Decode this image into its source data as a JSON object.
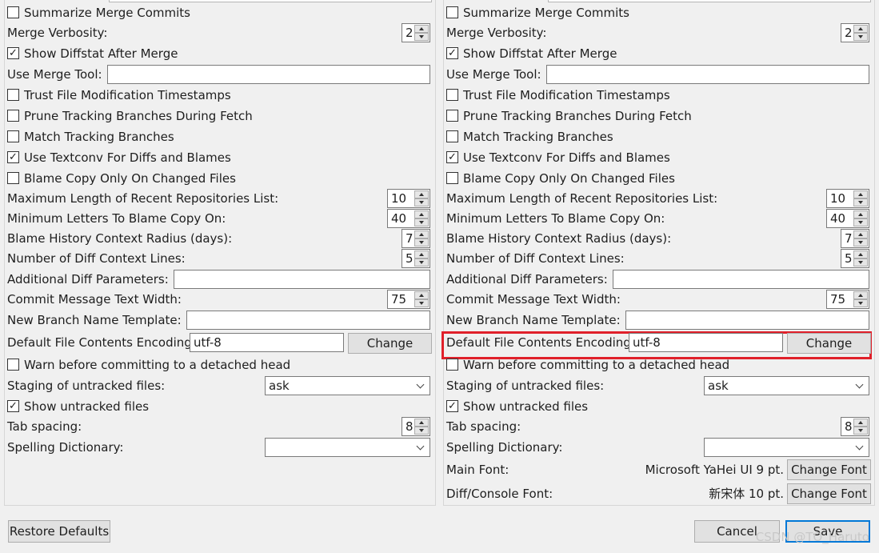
{
  "panels": [
    {
      "items": [
        {
          "kind": "checkbox",
          "label": "Summarize Merge Commits",
          "checked": false
        },
        {
          "kind": "spin",
          "label": "Merge Verbosity:",
          "value": "2"
        },
        {
          "kind": "checkbox",
          "label": "Show Diffstat After Merge",
          "checked": true
        },
        {
          "kind": "input",
          "label": "Use Merge Tool:",
          "value": ""
        },
        {
          "kind": "checkbox",
          "label": "Trust File Modification Timestamps",
          "checked": false
        },
        {
          "kind": "checkbox",
          "label": "Prune Tracking Branches During Fetch",
          "checked": false
        },
        {
          "kind": "checkbox",
          "label": "Match Tracking Branches",
          "checked": false
        },
        {
          "kind": "checkbox",
          "label": "Use Textconv For Diffs and Blames",
          "checked": true
        },
        {
          "kind": "checkbox",
          "label": "Blame Copy Only On Changed Files",
          "checked": false
        },
        {
          "kind": "spin",
          "label": "Maximum Length of Recent Repositories List:",
          "value": "10"
        },
        {
          "kind": "spin",
          "label": "Minimum Letters To Blame Copy On:",
          "value": "40"
        },
        {
          "kind": "spin",
          "label": "Blame History Context Radius (days):",
          "value": "7"
        },
        {
          "kind": "spin",
          "label": "Number of Diff Context Lines:",
          "value": "5"
        },
        {
          "kind": "input",
          "label": "Additional Diff Parameters:",
          "value": ""
        },
        {
          "kind": "spin",
          "label": "Commit Message Text Width:",
          "value": "75"
        },
        {
          "kind": "input",
          "label": "New Branch Name Template:",
          "value": ""
        },
        {
          "kind": "encoding",
          "label": "Default File Contents Encoding:",
          "value": "utf-8",
          "button": "Change"
        },
        {
          "kind": "checkbox",
          "label": "Warn before committing to a detached head",
          "checked": false
        },
        {
          "kind": "select",
          "label": "Staging of untracked files:",
          "value": "ask"
        },
        {
          "kind": "checkbox",
          "label": "Show untracked files",
          "checked": true
        },
        {
          "kind": "spin",
          "label": "Tab spacing:",
          "value": "8"
        },
        {
          "kind": "select",
          "label": "Spelling Dictionary:",
          "value": ""
        }
      ]
    },
    {
      "items": [
        {
          "kind": "checkbox",
          "label": "Summarize Merge Commits",
          "checked": false
        },
        {
          "kind": "spin",
          "label": "Merge Verbosity:",
          "value": "2"
        },
        {
          "kind": "checkbox",
          "label": "Show Diffstat After Merge",
          "checked": true
        },
        {
          "kind": "input",
          "label": "Use Merge Tool:",
          "value": ""
        },
        {
          "kind": "checkbox",
          "label": "Trust File Modification Timestamps",
          "checked": false
        },
        {
          "kind": "checkbox",
          "label": "Prune Tracking Branches During Fetch",
          "checked": false
        },
        {
          "kind": "checkbox",
          "label": "Match Tracking Branches",
          "checked": false
        },
        {
          "kind": "checkbox",
          "label": "Use Textconv For Diffs and Blames",
          "checked": true
        },
        {
          "kind": "checkbox",
          "label": "Blame Copy Only On Changed Files",
          "checked": false
        },
        {
          "kind": "spin",
          "label": "Maximum Length of Recent Repositories List:",
          "value": "10"
        },
        {
          "kind": "spin",
          "label": "Minimum Letters To Blame Copy On:",
          "value": "40"
        },
        {
          "kind": "spin",
          "label": "Blame History Context Radius (days):",
          "value": "7"
        },
        {
          "kind": "spin",
          "label": "Number of Diff Context Lines:",
          "value": "5"
        },
        {
          "kind": "input",
          "label": "Additional Diff Parameters:",
          "value": ""
        },
        {
          "kind": "spin",
          "label": "Commit Message Text Width:",
          "value": "75"
        },
        {
          "kind": "input",
          "label": "New Branch Name Template:",
          "value": ""
        },
        {
          "kind": "encoding",
          "label": "Default File Contents Encoding:",
          "value": "utf-8",
          "button": "Change"
        },
        {
          "kind": "checkbox",
          "label": "Warn before committing to a detached head",
          "checked": false
        },
        {
          "kind": "select",
          "label": "Staging of untracked files:",
          "value": "ask"
        },
        {
          "kind": "checkbox",
          "label": "Show untracked files",
          "checked": true
        },
        {
          "kind": "spin",
          "label": "Tab spacing:",
          "value": "8"
        },
        {
          "kind": "select",
          "label": "Spelling Dictionary:",
          "value": ""
        },
        {
          "kind": "font",
          "label": "Main Font:",
          "value": "Microsoft YaHei UI 9 pt.",
          "button": "Change Font"
        },
        {
          "kind": "font",
          "label": "Diff/Console Font:",
          "value": "新宋体 10 pt.",
          "button": "Change Font"
        }
      ]
    }
  ],
  "highlight_color": "#e0202a",
  "bottom_bar": {
    "restore_label": "Restore Defaults",
    "cancel_label": "Cancel",
    "save_label": "Save"
  },
  "watermark": "CSDN @TO_Haruto"
}
